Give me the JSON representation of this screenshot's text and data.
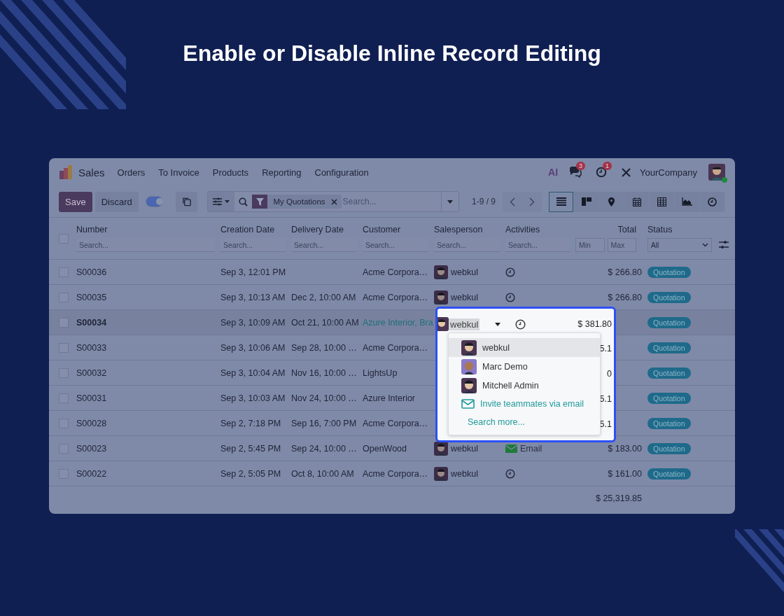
{
  "title": "Enable or Disable Inline Record Editing",
  "app": {
    "name": "Sales",
    "menu": [
      "Orders",
      "To Invoice",
      "Products",
      "Reporting",
      "Configuration"
    ],
    "ai_label": "AI",
    "message_count": "3",
    "activity_count": "1",
    "company": "YourCompany",
    "user_online": true
  },
  "toolbar": {
    "save": "Save",
    "discard": "Discard",
    "toggle_on": true,
    "facet": "My Quotations",
    "search_placeholder": "Search...",
    "pager": "1-9 / 9",
    "views": [
      {
        "kind": "list",
        "selected": true
      },
      {
        "kind": "kanban",
        "selected": false
      },
      {
        "kind": "map",
        "selected": false
      },
      {
        "kind": "calendar",
        "selected": false
      },
      {
        "kind": "pivot",
        "selected": false
      },
      {
        "kind": "graph",
        "selected": false
      },
      {
        "kind": "activity",
        "selected": false
      }
    ]
  },
  "table": {
    "columns": [
      {
        "label": "Number",
        "placeholder": "Search..."
      },
      {
        "label": "Creation Date",
        "placeholder": "Search..."
      },
      {
        "label": "Delivery Date",
        "placeholder": "Search..."
      },
      {
        "label": "Customer",
        "placeholder": "Search..."
      },
      {
        "label": "Salesperson",
        "placeholder": "Search..."
      },
      {
        "label": "Activities",
        "placeholder": "Search..."
      }
    ],
    "total": {
      "label": "Total",
      "min_placeholder": "Min",
      "max_placeholder": "Max"
    },
    "status": {
      "label": "Status",
      "value": "All"
    },
    "all_checked": false,
    "rows": [
      {
        "number": "S00036",
        "created": "Sep 3, 12:01 PM",
        "customer": "Acme Corpora…",
        "salesperson": "webkul",
        "activity": {
          "kind": "clock"
        },
        "total": "$ 266.80",
        "status": "Quotation",
        "editing": false,
        "checked": false
      },
      {
        "number": "S00035",
        "created": "Sep 3, 10:13 AM",
        "delivery": "Dec 2, 10:00 AM",
        "customer": "Acme Corpora…",
        "salesperson": "webkul",
        "activity": {
          "kind": "clock"
        },
        "total": "$ 266.80",
        "status": "Quotation",
        "editing": false,
        "checked": false
      },
      {
        "number": "S00034",
        "created": "Sep 3, 10:09 AM",
        "delivery": "Oct 21, 10:00 AM",
        "customer": "Azure Interior, Bra",
        "status": "Quotation",
        "editing": true,
        "checked": false
      },
      {
        "number": "S00033",
        "created": "Sep 3, 10:06 AM",
        "delivery": "Sep 28, 10:00 …",
        "customer": "Acme Corpora…",
        "status": "Quotation",
        "editing": false,
        "checked": false
      },
      {
        "number": "S00032",
        "created": "Sep 3, 10:04 AM",
        "delivery": "Nov 16, 10:00 …",
        "customer": "LightsUp",
        "status": "Quotation",
        "editing": false,
        "checked": false
      },
      {
        "number": "S00031",
        "created": "Sep 3, 10:03 AM",
        "delivery": "Nov 24, 10:00 …",
        "customer": "Azure Interior",
        "status": "Quotation",
        "editing": false,
        "checked": false
      },
      {
        "number": "S00028",
        "created": "Sep 2, 7:18 PM",
        "delivery": "Sep 16, 7:00 PM",
        "customer": "Acme Corpora…",
        "status": "Quotation",
        "editing": false,
        "checked": false
      },
      {
        "number": "S00023",
        "created": "Sep 2, 5:45 PM",
        "delivery": "Sep 24, 10:00 …",
        "customer": "OpenWood",
        "salesperson": "webkul",
        "activity": {
          "kind": "email",
          "label": "Email"
        },
        "total": "$ 183.00",
        "status": "Quotation",
        "editing": false,
        "checked": false
      },
      {
        "number": "S00022",
        "created": "Sep 2, 5:05 PM",
        "delivery": "Oct 8, 10:00 AM",
        "customer": "Acme Corpora…",
        "salesperson": "webkul",
        "activity": {
          "kind": "clock"
        },
        "total": "$ 161.00",
        "status": "Quotation",
        "editing": false,
        "checked": false
      }
    ],
    "footer_total": "$ 25,319.85"
  },
  "editor": {
    "salesperson": "webkul",
    "total": "$ 381.80",
    "options": [
      {
        "kind": "user",
        "label": "webkul",
        "selected": true
      },
      {
        "kind": "user",
        "label": "Marc Demo",
        "selected": false
      },
      {
        "kind": "user",
        "label": "Mitchell Admin",
        "selected": false
      },
      {
        "kind": "invite",
        "label": "Invite teammates via email"
      },
      {
        "kind": "more",
        "label": "Search more..."
      }
    ],
    "peek_totals": [
      "5.1",
      "0",
      "5.1",
      "5.1"
    ]
  }
}
